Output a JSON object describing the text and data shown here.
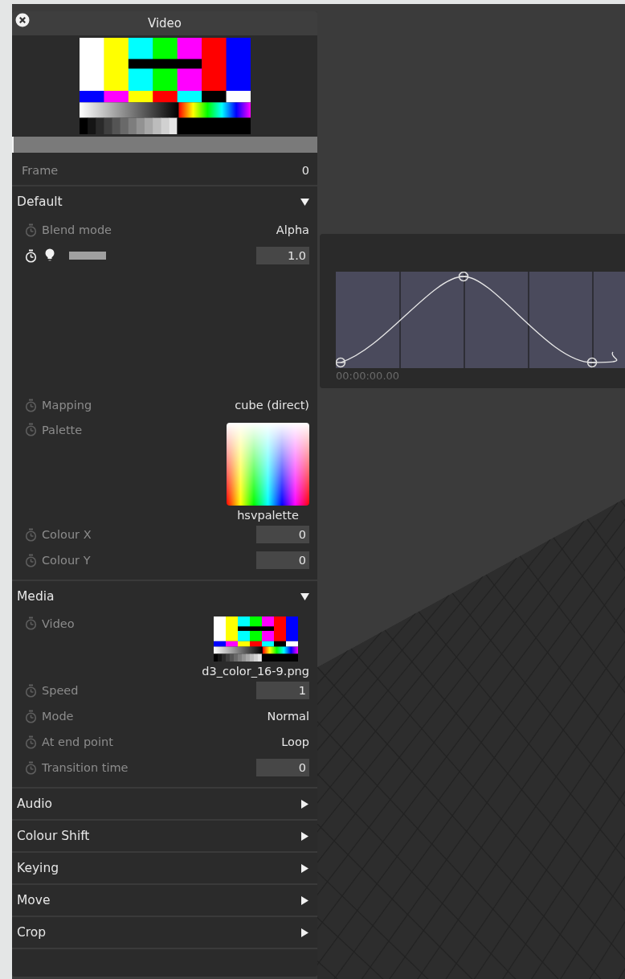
{
  "panel": {
    "title": "Video",
    "scrub": {
      "level": 0
    },
    "frame": {
      "label": "Frame",
      "value": "0"
    },
    "sections": [
      {
        "title": "Default",
        "expanded": true,
        "rows": [
          {
            "kind": "value",
            "label": "Blend mode",
            "animated": false,
            "value": "Alpha"
          },
          {
            "kind": "opacity",
            "animated": true,
            "level": 1,
            "value": "1.0"
          },
          {
            "kind": "value",
            "label": "Mapping",
            "animated": false,
            "value": "cube (direct)"
          },
          {
            "kind": "palette",
            "label": "Palette",
            "animated": false,
            "caption": "hsvpalette"
          },
          {
            "kind": "field",
            "label": "Colour X",
            "animated": false,
            "value": "0"
          },
          {
            "kind": "field",
            "label": "Colour Y",
            "animated": false,
            "value": "0"
          }
        ]
      },
      {
        "title": "Media",
        "expanded": true,
        "rows": [
          {
            "kind": "media",
            "label": "Video",
            "animated": false,
            "caption": "d3_color_16-9.png"
          },
          {
            "kind": "field",
            "label": "Speed",
            "animated": false,
            "value": "1"
          },
          {
            "kind": "value",
            "label": "Mode",
            "animated": false,
            "value": "Normal"
          },
          {
            "kind": "value",
            "label": "At end point",
            "animated": false,
            "value": "Loop"
          },
          {
            "kind": "field",
            "label": "Transition time",
            "animated": false,
            "value": "0"
          }
        ]
      },
      {
        "title": "Audio",
        "expanded": false
      },
      {
        "title": "Colour Shift",
        "expanded": false
      },
      {
        "title": "Keying",
        "expanded": false
      },
      {
        "title": "Move",
        "expanded": false
      },
      {
        "title": "Crop",
        "expanded": false
      }
    ]
  },
  "curve_editor": {
    "time": "00:00:00.00"
  }
}
